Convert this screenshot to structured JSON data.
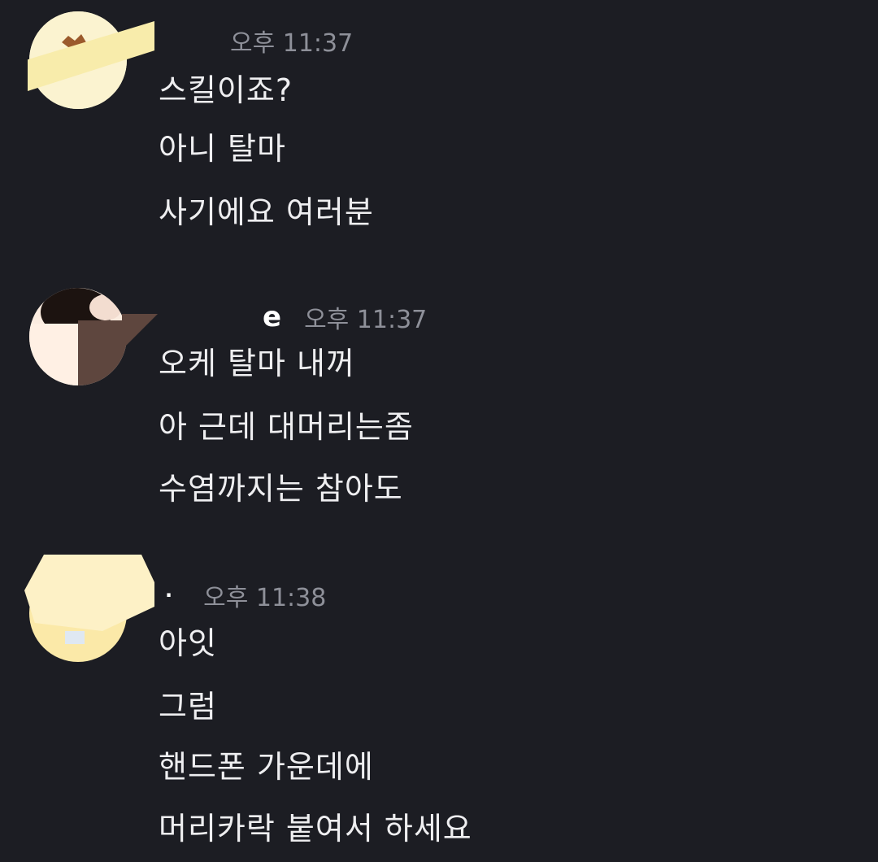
{
  "messages": [
    {
      "username": "",
      "timestamp": "오후 11:37",
      "lines": [
        "스킬이죠?",
        "아니 탈마",
        "사기에요 여러분"
      ]
    },
    {
      "username": "e",
      "timestamp": "오후 11:37",
      "lines": [
        "오케 탈마 내꺼",
        "아 근데 대머리는좀",
        "수염까지는 참아도"
      ]
    },
    {
      "username": "·",
      "timestamp": "오후 11:38",
      "lines": [
        "아잇",
        "그럼",
        "핸드폰 가운데에",
        "머리카락 붙여서 하세요"
      ]
    }
  ],
  "colors": {
    "background": "#1c1d23",
    "message_text": "#eeeef0",
    "timestamp_text": "#8e9099",
    "username_text": "#ffffff"
  }
}
